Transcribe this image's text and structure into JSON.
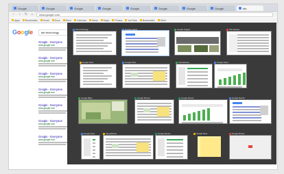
{
  "browser": {
    "tabs": [
      {
        "label": "Google"
      },
      {
        "label": "Google"
      },
      {
        "label": "Google"
      },
      {
        "label": "Google"
      },
      {
        "label": "Google"
      },
      {
        "label": "Google"
      },
      {
        "label": "Google"
      },
      {
        "label": "Google"
      },
      {
        "label": "tab",
        "active": true
      }
    ],
    "omnibox": "www.google.com"
  },
  "bookmarks": [
    "Apps",
    "Bookmarks",
    "Gmail",
    "Docs",
    "Drive",
    "Calendar",
    "News",
    "Maps",
    "Photos",
    "YouTube",
    "Bookmarks",
    "Other"
  ],
  "search": {
    "logo": [
      "G",
      "o",
      "o",
      "g",
      "l",
      "e"
    ],
    "query": "tab technology"
  },
  "results": [
    {
      "title": "Google - Everyone",
      "url": "www.google.com"
    },
    {
      "title": "Google - Everyone",
      "url": "www.google.com"
    },
    {
      "title": "Google - Everyone",
      "url": "www.google.com"
    },
    {
      "title": "Google - Everyone",
      "url": "www.google.com"
    },
    {
      "title": "Google - Everyone",
      "url": "www.google.com"
    },
    {
      "title": "Google - Everyone",
      "url": "www.google.com"
    },
    {
      "title": "Google - Everyone",
      "url": "www.google.com"
    }
  ],
  "overlay": {
    "thumbnails": [
      {
        "title": "Tab technology",
        "fav": "#4285f4",
        "selected": false
      },
      {
        "title": "Google search",
        "fav": "#4285f4",
        "selected": true
      },
      {
        "title": "Google Images",
        "fav": "#34a853",
        "selected": false
      },
      {
        "title": "Tab settings",
        "fav": "#ea4335",
        "selected": false
      },
      {
        "title": "Google Docs",
        "fav": "#f4b400",
        "selected": false
      },
      {
        "title": "Google Drive",
        "fav": "#4285f4",
        "selected": false
      },
      {
        "title": "Spreadsheet",
        "fav": "#34a853",
        "selected": false
      },
      {
        "title": "Google News",
        "fav": "#4285f4",
        "selected": false
      },
      {
        "title": "Google Maps",
        "fav": "#34a853",
        "selected": false
      },
      {
        "title": "Google Sheets",
        "fav": "#0f9d58",
        "selected": false
      },
      {
        "title": "Google Sheets",
        "fav": "#0f9d58",
        "selected": false
      },
      {
        "title": "Google Search",
        "fav": "#4285f4",
        "selected": false
      },
      {
        "title": "Google Docs",
        "fav": "#4285f4",
        "selected": false
      },
      {
        "title": "Spreadsheet",
        "fav": "#f4b400",
        "selected": false
      },
      {
        "title": "Google Sheets",
        "fav": "#0f9d58",
        "selected": false
      },
      {
        "title": "Google Keep",
        "fav": "#f4b400",
        "selected": false
      },
      {
        "title": "Google Photos",
        "fav": "#ea4335",
        "selected": false
      }
    ]
  }
}
